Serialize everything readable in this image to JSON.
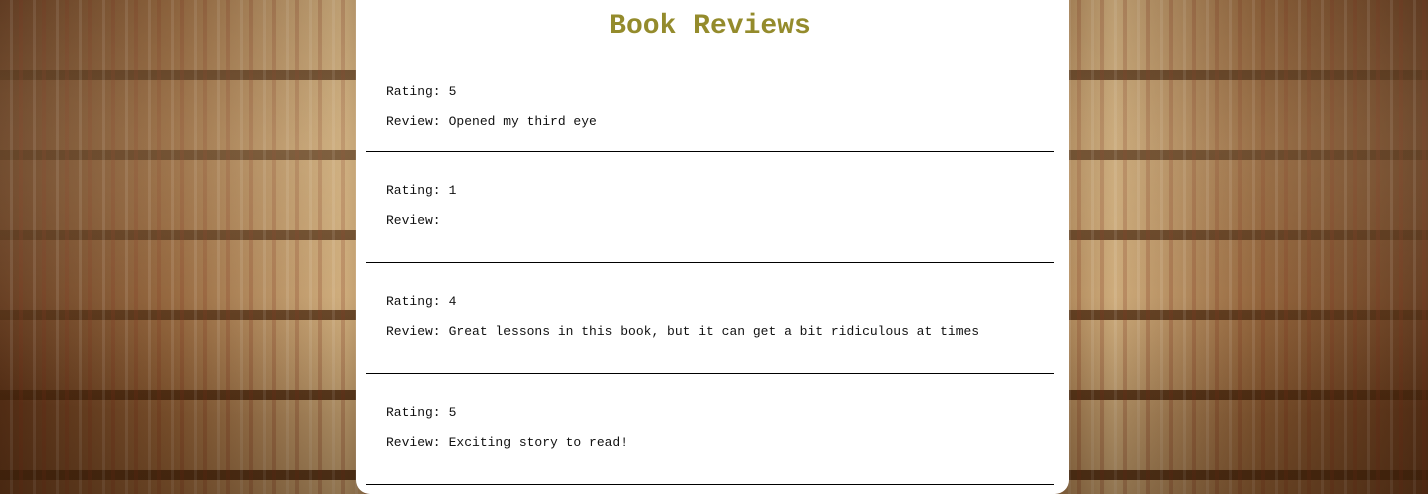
{
  "page": {
    "title": "Book Reviews"
  },
  "labels": {
    "rating": "Rating:",
    "review": "Review:"
  },
  "reviews": [
    {
      "rating": "5",
      "text": "Opened my third eye"
    },
    {
      "rating": "1",
      "text": ""
    },
    {
      "rating": "4",
      "text": "Great lessons in this book, but it can get a bit ridiculous at times"
    },
    {
      "rating": "5",
      "text": "Exciting story to read!"
    }
  ],
  "colors": {
    "title": "#948b2c",
    "panel_background": "#ffffff",
    "divider": "#000000"
  }
}
